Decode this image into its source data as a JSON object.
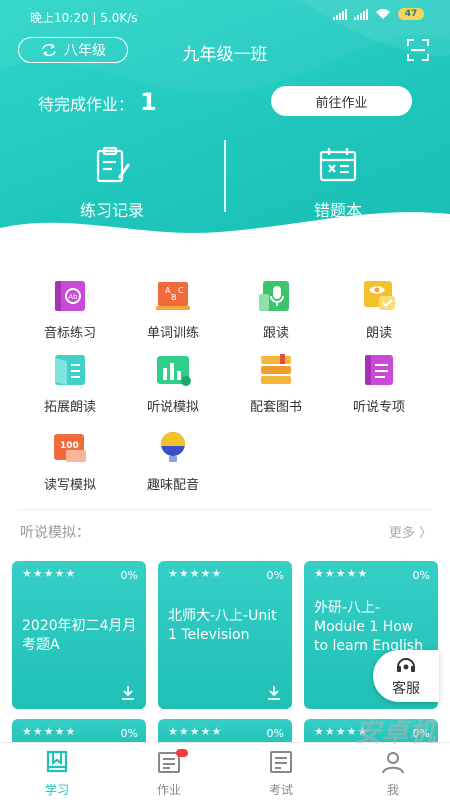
{
  "status": {
    "time": "晚上10:20 | 5.0K/s",
    "battery": "47"
  },
  "header": {
    "grade_button": "八年级",
    "class_title": "九年级一班",
    "pending_label": "待完成作业：",
    "pending_count": "1",
    "goto_button": "前往作业",
    "cards": [
      {
        "label": "练习记录",
        "icon": "clipboard-edit-icon"
      },
      {
        "label": "错题本",
        "icon": "calendar-x-icon"
      }
    ]
  },
  "features": [
    {
      "label": "音标练习",
      "icon": "phonetic-book-icon",
      "color": "#c94ad6"
    },
    {
      "label": "单词训练",
      "icon": "abc-board-icon",
      "color": "#f06a3b"
    },
    {
      "label": "跟读",
      "icon": "microphone-icon",
      "color": "#3bc46b"
    },
    {
      "label": "朗读",
      "icon": "read-eye-icon",
      "color": "#f5c12b"
    },
    {
      "label": "拓展朗读",
      "icon": "open-book-icon",
      "color": "#3fd1c9"
    },
    {
      "label": "听说模拟",
      "icon": "bar-chart-icon",
      "color": "#2fcf8a"
    },
    {
      "label": "配套图书",
      "icon": "book-stack-icon",
      "color": "#f4b73a"
    },
    {
      "label": "听说专项",
      "icon": "notebook-icon",
      "color": "#c94ad6"
    },
    {
      "label": "读写模拟",
      "icon": "score-100-icon",
      "color": "#f06a3b"
    },
    {
      "label": "趣味配音",
      "icon": "dubbing-bulb-icon",
      "color": "#3a4fc9"
    }
  ],
  "section": {
    "title": "听说模拟：",
    "more": "更多 〉"
  },
  "exercise_cards": [
    {
      "stars": "★★★★★",
      "percent": "0%",
      "title": "2020年初二4月月考题A"
    },
    {
      "stars": "★★★★★",
      "percent": "0%",
      "title": "北师大-八上-Unit 1 Television"
    },
    {
      "stars": "★★★★★",
      "percent": "0%",
      "title": "外研-八上-Module 1 How to learn English"
    },
    {
      "stars": "★★★★★",
      "percent": "0%",
      "title": ""
    },
    {
      "stars": "★★★★★",
      "percent": "0%",
      "title": ""
    },
    {
      "stars": "★★★★★",
      "percent": "0%",
      "title": ""
    }
  ],
  "service": {
    "label": "客服"
  },
  "tabs": [
    {
      "label": "学习",
      "icon": "study-book-icon",
      "active": true
    },
    {
      "label": "作业",
      "icon": "homework-icon",
      "active": false
    },
    {
      "label": "考试",
      "icon": "exam-icon",
      "active": false
    },
    {
      "label": "我",
      "icon": "profile-icon",
      "active": false
    }
  ],
  "watermark": "安卓机",
  "colors": {
    "accent": "#22c1b7",
    "hero": "#1fc7bd",
    "badge": "#f43b3b"
  }
}
